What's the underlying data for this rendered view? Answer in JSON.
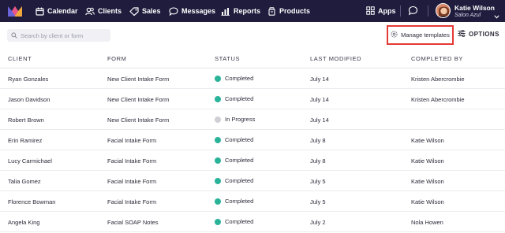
{
  "nav": {
    "items": [
      {
        "label": "Calendar",
        "icon": "calendar-icon"
      },
      {
        "label": "Clients",
        "icon": "clients-icon"
      },
      {
        "label": "Sales",
        "icon": "tag-icon"
      },
      {
        "label": "Messages",
        "icon": "messages-icon"
      },
      {
        "label": "Reports",
        "icon": "bar-chart-icon"
      },
      {
        "label": "Products",
        "icon": "products-icon"
      }
    ],
    "apps_label": "Apps",
    "user_name": "Katie Wilson",
    "salon_name": "Salon Azul"
  },
  "toolbar": {
    "search_placeholder": "Search by client or form",
    "manage_templates_label": "Manage templates",
    "options_label": "OPTIONS"
  },
  "table": {
    "columns": [
      "CLIENT",
      "FORM",
      "STATUS",
      "LAST MODIFIED",
      "COMPLETED BY"
    ],
    "rows": [
      {
        "client": "Ryan Gonzales",
        "form": "New Client Intake Form",
        "status": "Completed",
        "modified": "July 14",
        "completed_by": "Kristen Abercrombie"
      },
      {
        "client": "Jason Davidson",
        "form": "New Client Intake Form",
        "status": "Completed",
        "modified": "July 14",
        "completed_by": "Kristen Abercrombie"
      },
      {
        "client": "Robert Brown",
        "form": "New Client Intake Form",
        "status": "In Progress",
        "modified": "July 14",
        "completed_by": ""
      },
      {
        "client": "Erin Ramirez",
        "form": "Facial Intake Form",
        "status": "Completed",
        "modified": "July 8",
        "completed_by": "Katie Wilson"
      },
      {
        "client": "Lucy Carmichael",
        "form": "Facial Intake Form",
        "status": "Completed",
        "modified": "July 8",
        "completed_by": "Katie Wilson"
      },
      {
        "client": "Talia Gomez",
        "form": "Facial Intake Form",
        "status": "Completed",
        "modified": "July 5",
        "completed_by": "Katie Wilson"
      },
      {
        "client": "Florence Bowman",
        "form": "Facial Intake Form",
        "status": "Completed",
        "modified": "July 5",
        "completed_by": "Katie Wilson"
      },
      {
        "client": "Angela King",
        "form": "Facial SOAP Notes",
        "status": "Completed",
        "modified": "July 2",
        "completed_by": "Nola Howen"
      }
    ]
  },
  "colors": {
    "topbar": "#1f1c3d",
    "completed": "#2bb39a",
    "in_progress": "#cfcfd6",
    "highlight": "#e53935"
  }
}
